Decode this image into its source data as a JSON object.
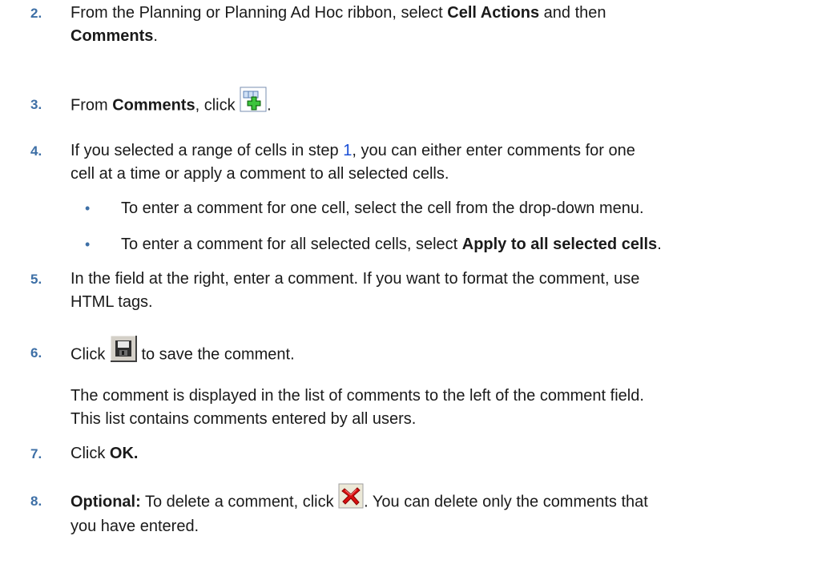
{
  "steps": [
    {
      "number": "2.",
      "line1_pre": "From the Planning or Planning Ad Hoc ribbon, select ",
      "line1_bold": "Cell Actions",
      "line1_post": " and then",
      "line2_bold": "Comments",
      "line2_post": "."
    },
    {
      "number": "3.",
      "pre": "From ",
      "bold": "Comments",
      "mid": ", click ",
      "post": ".",
      "icon": "add-comment-icon"
    },
    {
      "number": "4.",
      "pre": "If you selected a range of cells in step ",
      "link": "1",
      "post": ", you can either enter comments for one",
      "line2": "cell at a time or apply a comment to all selected cells.",
      "bullets": [
        {
          "text": "To enter a comment for one cell, select the cell from the drop-down menu."
        },
        {
          "pre": "To enter a comment for all selected cells, select ",
          "bold": "Apply to all selected cells",
          "post": "."
        }
      ]
    },
    {
      "number": "5.",
      "line1": "In the field at the right, enter a comment. If you want to format the comment, use",
      "line2": "HTML tags."
    },
    {
      "number": "6.",
      "pre": "Click ",
      "post": " to save the comment.",
      "icon": "save-icon",
      "para_line1": "The comment is displayed in the list of comments to the left of the comment field.",
      "para_line2": "This list contains comments entered by all users."
    },
    {
      "number": "7.",
      "pre": "Click ",
      "bold": "OK."
    },
    {
      "number": "8.",
      "bold": "Optional:",
      "pre": " To delete a comment, click ",
      "post": ". You can delete only the comments that",
      "line2": "you have entered.",
      "icon": "delete-icon"
    }
  ],
  "colors": {
    "number": "#3d6fa6",
    "link": "#1a4fd6",
    "text": "#1a1a1a"
  }
}
